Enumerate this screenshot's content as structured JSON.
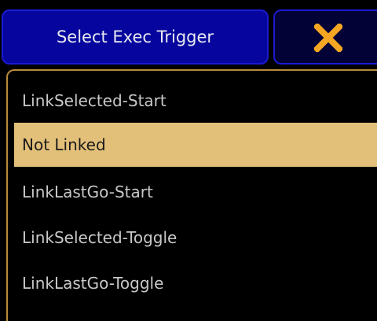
{
  "dialog": {
    "title": "Select Exec Trigger",
    "close_icon": "close-x-icon",
    "accent_color": "#f5a623"
  },
  "options": [
    {
      "label": "LinkSelected-Start",
      "selected": false
    },
    {
      "label": "Not Linked",
      "selected": true
    },
    {
      "label": "LinkLastGo-Start",
      "selected": false
    },
    {
      "label": "LinkSelected-Toggle",
      "selected": false
    },
    {
      "label": "LinkLastGo-Toggle",
      "selected": false
    }
  ]
}
